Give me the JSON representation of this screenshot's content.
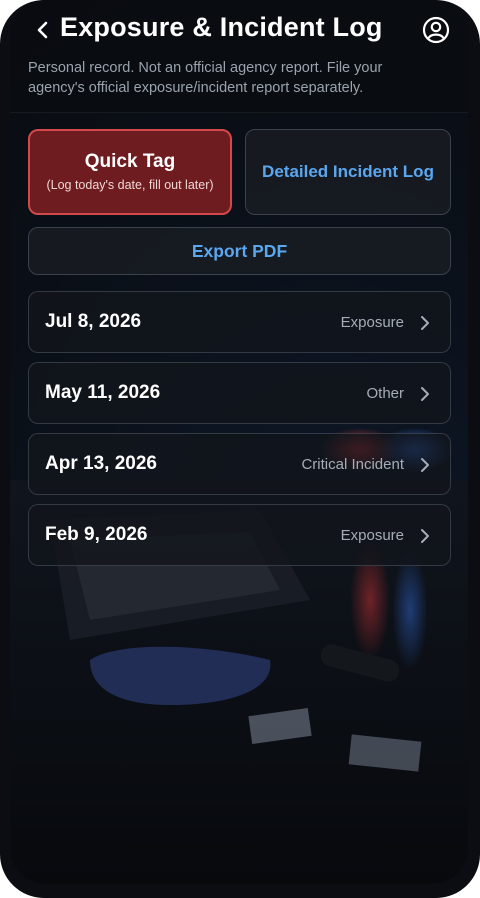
{
  "header": {
    "title": "Exposure & Incident Log",
    "subtitle": "Personal record. Not an official agency report. File your agency's official exposure/incident report separately."
  },
  "actions": {
    "quick_tag": {
      "label": "Quick Tag",
      "sublabel": "(Log today's date, fill out later)"
    },
    "detailed_label": "Detailed Incident Log",
    "export_label": "Export PDF"
  },
  "entries": [
    {
      "date": "Jul 8, 2026",
      "type": "Exposure"
    },
    {
      "date": "May 11, 2026",
      "type": "Other"
    },
    {
      "date": "Apr 13, 2026",
      "type": "Critical Incident"
    },
    {
      "date": "Feb 9, 2026",
      "type": "Exposure"
    }
  ],
  "icons": {
    "back": "chevron-left-icon",
    "profile": "user-circle-icon",
    "row_chevron": "chevron-right-icon"
  },
  "colors": {
    "accent_blue": "#5aa7f0",
    "quick_tag_fill": "#6e1c1f",
    "quick_tag_border": "#d1494a",
    "background": "#0b0d12"
  }
}
